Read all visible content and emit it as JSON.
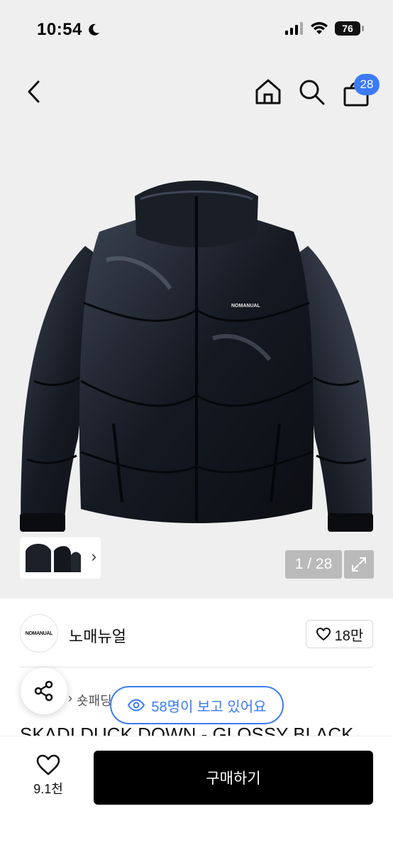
{
  "status_bar": {
    "time": "10:54",
    "battery": "76"
  },
  "nav": {
    "back_icon": "chevron-left-icon",
    "home_icon": "home-icon",
    "search_icon": "search-icon",
    "cart_icon": "shopping-bag-icon",
    "cart_count": "28"
  },
  "gallery": {
    "counter": "1 / 28",
    "expand_icon": "expand-icon",
    "thumb_chevron": "›"
  },
  "product_image": {
    "logo_text": "NOMANUAL"
  },
  "brand": {
    "logo_text": "NOMANUAL",
    "name": "노매뉴얼",
    "like_count": "18만"
  },
  "breadcrumb": {
    "separator": "›",
    "category": "숏패딩"
  },
  "viewers": {
    "text": "58명이 보고 있어요"
  },
  "product": {
    "title": "SKADI DUCK DOWN - GLOSSY BLACK"
  },
  "bottom_bar": {
    "wish_count": "9.1천",
    "buy_label": "구매하기"
  },
  "colors": {
    "accent": "#3b7bf6",
    "hero_bg": "#efefef",
    "buy_button": "#000000"
  }
}
